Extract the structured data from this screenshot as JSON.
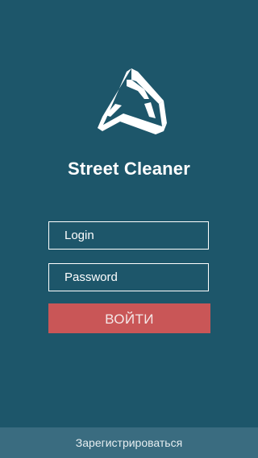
{
  "app": {
    "title": "Street Cleaner",
    "logo_icon": "street-cleaner-logo-icon"
  },
  "form": {
    "login_placeholder": "Login",
    "login_value": "",
    "password_placeholder": "Password",
    "password_value": "",
    "submit_label": "ВОЙТИ"
  },
  "footer": {
    "register_label": "Зарегистрироваться"
  },
  "colors": {
    "background": "#1d566a",
    "accent": "#c95657",
    "footer": "#3a6c80",
    "text": "#ffffff"
  }
}
